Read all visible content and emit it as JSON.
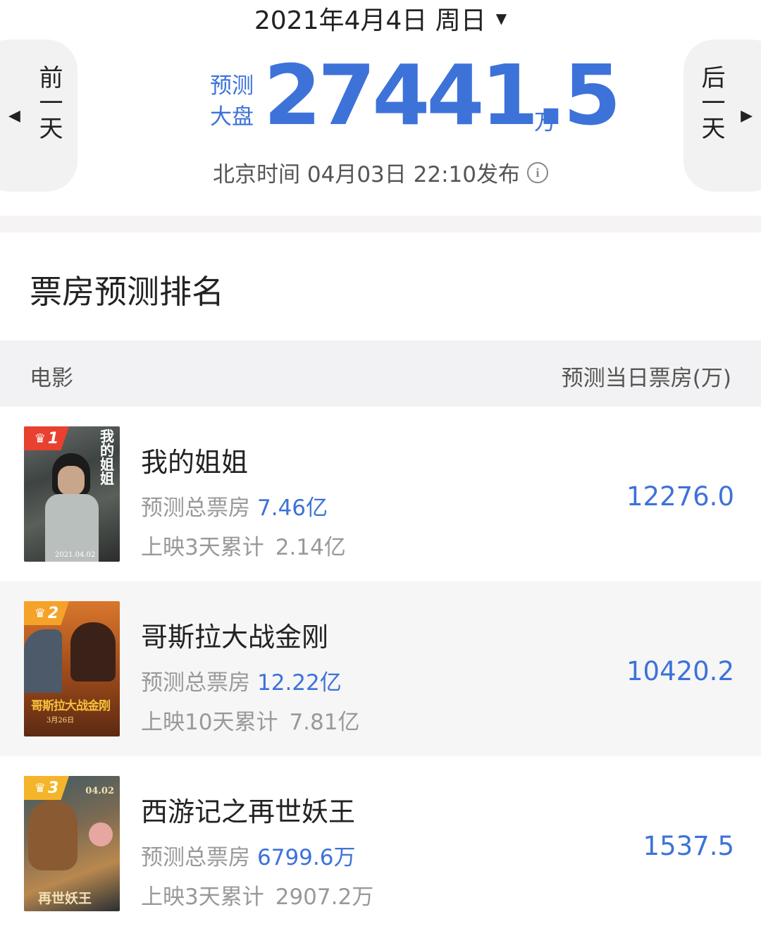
{
  "header": {
    "date": "2021年4月4日 周日",
    "prev_label": "前一天",
    "next_label": "后一天",
    "forecast_label_line1": "预测",
    "forecast_label_line2": "大盘",
    "forecast_value": "27441.5",
    "forecast_unit": "万",
    "publish_text": "北京时间 04月03日 22:10发布"
  },
  "ranking": {
    "title": "票房预测排名",
    "col_movie": "电影",
    "col_forecast": "预测当日票房(万)",
    "movies": [
      {
        "rank": "1",
        "title": "我的姐姐",
        "total_label": "预测总票房",
        "total_value": "7.46亿",
        "cum_label": "上映3天累计",
        "cum_value": "2.14亿",
        "day_forecast": "12276.0",
        "badge_color": "#e8412f"
      },
      {
        "rank": "2",
        "title": "哥斯拉大战金刚",
        "total_label": "预测总票房",
        "total_value": "12.22亿",
        "cum_label": "上映10天累计",
        "cum_value": "7.81亿",
        "day_forecast": "10420.2",
        "badge_color": "#f5a22a"
      },
      {
        "rank": "3",
        "title": "西游记之再世妖王",
        "total_label": "预测总票房",
        "total_value": "6799.6万",
        "cum_label": "上映3天累计",
        "cum_value": "2907.2万",
        "day_forecast": "1537.5",
        "badge_color": "#f5b52a"
      }
    ]
  },
  "posters": {
    "p1_vertical": "我的姐姐",
    "p1_date": "2021.04.02",
    "p2_title": "哥斯拉大战金刚",
    "p2_date": "3月26日",
    "p3_date": "04.02",
    "p3_title": "再世妖王"
  },
  "colors": {
    "accent": "#3d72d9",
    "divider": "#f6f3f5",
    "row_alt": "#f6f6f7"
  }
}
